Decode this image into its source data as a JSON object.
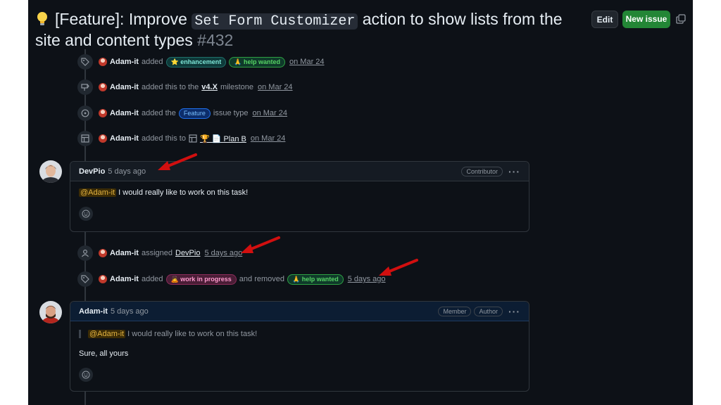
{
  "issue": {
    "title_prefix": "[Feature]: Improve ",
    "title_code": "Set Form Customizer",
    "title_suffix": " action to show lists from the site and content types ",
    "number": "#432"
  },
  "header": {
    "edit_label": "Edit",
    "new_issue_label": "New issue"
  },
  "timeline": {
    "e1": {
      "actor": "Adam-it",
      "verb": "added",
      "label1": "⭐ enhancement",
      "label2": "🙏 help wanted",
      "date": "on Mar 24"
    },
    "e2": {
      "actor": "Adam-it",
      "verb": "added this to the",
      "milestone": "v4.X",
      "verb2": "milestone",
      "date": "on Mar 24"
    },
    "e3": {
      "actor": "Adam-it",
      "verb": "added the",
      "type_label": "Feature",
      "verb2": "issue type",
      "date": "on Mar 24"
    },
    "e4": {
      "actor": "Adam-it",
      "verb": "added this to",
      "project": "🏆 📄 Plan B",
      "date": "on Mar 24"
    },
    "e5": {
      "actor": "Adam-it",
      "verb": "assigned",
      "assignee": "DevPio",
      "date": "5 days ago"
    },
    "e6": {
      "actor": "Adam-it",
      "verb": "added",
      "label_added": "🙇 work in progress",
      "verb2": "and removed",
      "label_removed": "🙏 help wanted",
      "date": "5 days ago"
    }
  },
  "comment1": {
    "author": "DevPio",
    "time": "5 days ago",
    "role": "Contributor",
    "mention": "@Adam-it",
    "text": " I would really like to work on this task!"
  },
  "comment2": {
    "author": "Adam-it",
    "time": "5 days ago",
    "role1": "Member",
    "role2": "Author",
    "quote_mention": "@Adam-it",
    "quote_text": " I would really like to work on this task!",
    "reply": "Sure, all yours"
  },
  "icons": {
    "bulb": "lightbulb-icon",
    "copy": "copy-icon",
    "tag": "tag-icon",
    "milestone": "milestone-icon",
    "issue_type": "issue-type-icon",
    "project": "project-table-icon",
    "person": "person-icon",
    "smiley": "smiley-icon",
    "kebab": "kebab-icon"
  },
  "colors": {
    "accent_green": "#238636",
    "annotation_red": "#d10f0f",
    "background": "#0d1117"
  }
}
